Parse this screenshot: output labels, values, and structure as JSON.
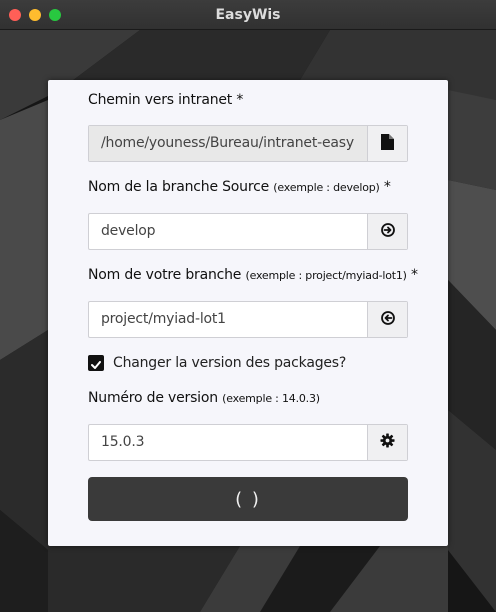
{
  "window": {
    "title": "EasyWis"
  },
  "form": {
    "path_label": "Chemin vers intranet *",
    "path_value": "/home/youness/Bureau/intranet-easy",
    "source_branch_label": "Nom de la branche Source",
    "source_branch_hint": "(exemple : develop)",
    "source_branch_required": "*",
    "source_branch_value": "develop",
    "your_branch_label": "Nom de votre branche",
    "your_branch_hint": "(exemple : project/myiad-lot1)",
    "your_branch_required": "*",
    "your_branch_value": "project/myiad-lot1",
    "packages_checkbox_label": "Changer la version des packages?",
    "packages_checkbox_checked": true,
    "version_label": "Numéro de version",
    "version_hint": "(exemple : 14.0.3)",
    "version_value": "15.0.3",
    "submit_label": "( )"
  },
  "icons": {
    "path_button": "file-icon",
    "source_branch_button": "circle-arrow-right-icon",
    "your_branch_button": "circle-arrow-left-icon",
    "version_button": "gear-icon",
    "checkbox": "check-icon"
  },
  "colors": {
    "card_bg": "#f6f6fb",
    "readonly_bg": "#e8e8e8",
    "submit_bg": "#3a3a3a",
    "close": "#ff5f57",
    "minimize": "#febc2e",
    "maximize": "#28c840"
  }
}
